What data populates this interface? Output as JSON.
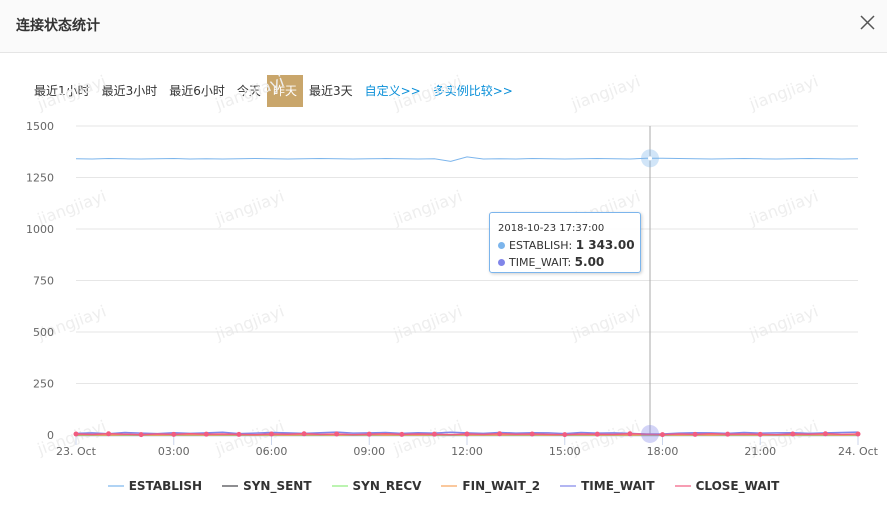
{
  "dialog": {
    "title": "连接状态统计",
    "close_icon": "close-icon"
  },
  "ranges": [
    {
      "label": "最近1小时",
      "active": false,
      "link": false
    },
    {
      "label": "最近3小时",
      "active": false,
      "link": false
    },
    {
      "label": "最近6小时",
      "active": false,
      "link": false
    },
    {
      "label": "今天",
      "active": false,
      "link": false
    },
    {
      "label": "昨天",
      "active": true,
      "link": false
    },
    {
      "label": "最近3天",
      "active": false,
      "link": false
    },
    {
      "label": "自定义>>",
      "active": false,
      "link": true
    },
    {
      "label": "多实例比较>>",
      "active": false,
      "link": true
    }
  ],
  "watermark": "jiangjiayi",
  "tooltip": {
    "time": "2018-10-23 17:37:00",
    "rows": [
      {
        "name": "ESTABLISH:",
        "value": "1 343.00",
        "color": "#7cb5ec"
      },
      {
        "name": "TIME_WAIT:",
        "value": "5.00",
        "color": "#8085e9"
      }
    ]
  },
  "chart_data": {
    "type": "line",
    "xlim": [
      "2018-10-23 00:00",
      "2018-10-24 00:00"
    ],
    "ylim": [
      0,
      1500
    ],
    "yticks": [
      "0",
      "250",
      "500",
      "750",
      "1000",
      "1250",
      "1500"
    ],
    "xticks": [
      "23. Oct",
      "03:00",
      "06:00",
      "09:00",
      "12:00",
      "15:00",
      "18:00",
      "21:00",
      "24. Oct"
    ],
    "grid": true,
    "legend_placement": "bottom",
    "x_start": "2018-10-23 00:00",
    "x_interval_minutes": 30,
    "crosshair": "2018-10-23 17:37",
    "series": [
      {
        "name": "ESTABLISH",
        "color": "#7cb5ec",
        "values": [
          1341,
          1340,
          1342,
          1341,
          1340,
          1341,
          1342,
          1340,
          1341,
          1340,
          1341,
          1342,
          1341,
          1340,
          1341,
          1342,
          1341,
          1340,
          1341,
          1342,
          1341,
          1340,
          1341,
          1328,
          1350,
          1340,
          1341,
          1340,
          1342,
          1341,
          1340,
          1341,
          1342,
          1341,
          1340,
          1343,
          1343,
          1342,
          1341,
          1340,
          1341,
          1342,
          1341,
          1340,
          1341,
          1342,
          1341,
          1340,
          1341
        ]
      },
      {
        "name": "SYN_SENT",
        "color": "#434348",
        "values": [
          0,
          0,
          0,
          0,
          0,
          0,
          0,
          0,
          0,
          0,
          0,
          0,
          0,
          0,
          0,
          0,
          0,
          0,
          0,
          0,
          0,
          0,
          0,
          0,
          0,
          0,
          0,
          0,
          0,
          0,
          0,
          0,
          0,
          0,
          0,
          0,
          0,
          0,
          0,
          0,
          0,
          0,
          0,
          0,
          0,
          0,
          0,
          0,
          0
        ]
      },
      {
        "name": "SYN_RECV",
        "color": "#90ed7d",
        "values": [
          0,
          0,
          0,
          0,
          0,
          0,
          0,
          0,
          0,
          0,
          0,
          0,
          0,
          0,
          0,
          0,
          0,
          0,
          0,
          0,
          0,
          0,
          0,
          0,
          0,
          0,
          0,
          0,
          0,
          0,
          0,
          0,
          0,
          0,
          0,
          0,
          0,
          0,
          0,
          0,
          0,
          0,
          0,
          0,
          0,
          0,
          0,
          0,
          0
        ]
      },
      {
        "name": "FIN_WAIT_2",
        "color": "#f7a35c",
        "values": [
          2,
          1,
          0,
          2,
          1,
          0,
          1,
          2,
          0,
          1,
          2,
          0,
          1,
          0,
          2,
          1,
          0,
          1,
          2,
          0,
          1,
          0,
          1,
          2,
          0,
          1,
          0,
          2,
          1,
          0,
          1,
          2,
          0,
          1,
          0,
          1,
          2,
          0,
          1,
          0,
          2,
          1,
          0,
          1,
          0,
          2,
          1,
          0,
          1
        ]
      },
      {
        "name": "TIME_WAIT",
        "color": "#8085e9",
        "values": [
          8,
          10,
          6,
          12,
          9,
          7,
          11,
          8,
          10,
          13,
          7,
          9,
          12,
          10,
          8,
          11,
          14,
          9,
          10,
          12,
          8,
          11,
          9,
          13,
          10,
          8,
          12,
          9,
          11,
          10,
          7,
          12,
          9,
          10,
          8,
          5,
          5,
          9,
          11,
          10,
          8,
          12,
          9,
          10,
          11,
          8,
          10,
          12,
          14
        ]
      },
      {
        "name": "CLOSE_WAIT",
        "color": "#f15c80",
        "values": [
          5,
          3,
          6,
          4,
          2,
          5,
          3,
          6,
          4,
          5,
          3,
          2,
          5,
          4,
          6,
          3,
          5,
          2,
          4,
          6,
          3,
          5,
          4,
          2,
          5,
          3,
          6,
          4,
          5,
          3,
          2,
          5,
          4,
          3,
          6,
          4,
          2,
          5,
          3,
          6,
          4,
          5,
          3,
          2,
          5,
          4,
          6,
          3,
          5
        ]
      }
    ]
  }
}
